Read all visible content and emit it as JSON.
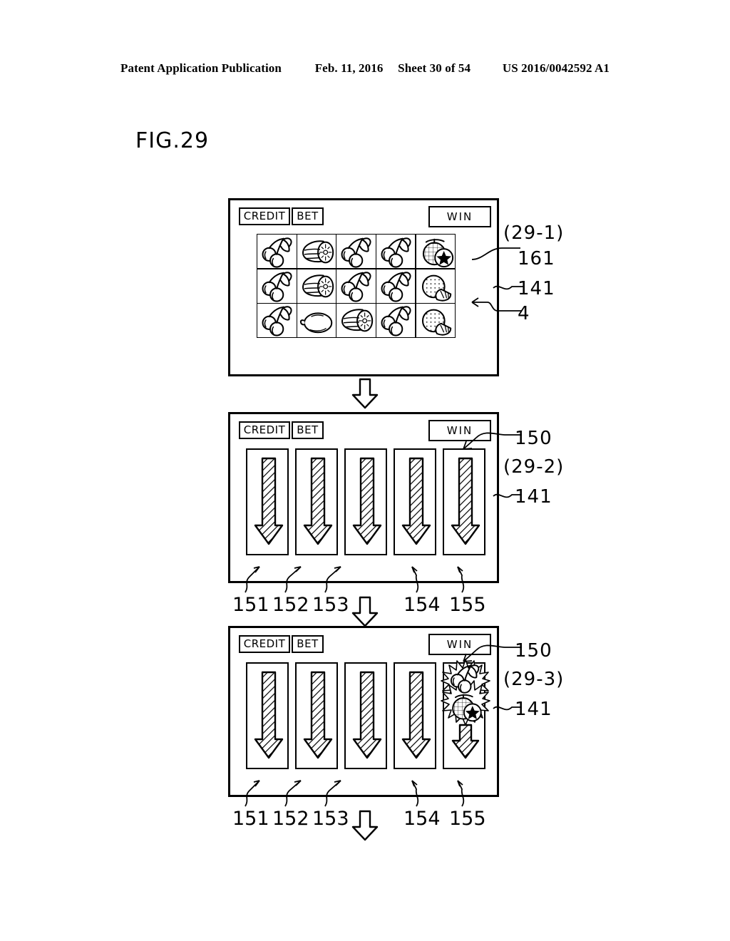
{
  "header": {
    "publication": "Patent Application Publication",
    "date": "Feb. 11, 2016",
    "sheet": "Sheet 30 of 54",
    "patent_number": "US 2016/0042592 A1"
  },
  "figure": {
    "label": "FIG.29"
  },
  "meters": {
    "credit_label": "CREDIT",
    "bet_label": "BET",
    "win_label": "WIN"
  },
  "panels": [
    {
      "id": "29-1",
      "step_label": "(29-1)",
      "callouts": [
        "161",
        "141",
        "4"
      ],
      "grid": {
        "columns": 5,
        "rows": 3,
        "symbols": [
          [
            "cherry",
            "melon-slice",
            "cherry",
            "cherry",
            "melon-star"
          ],
          [
            "cherry",
            "melon-slice",
            "cherry",
            "cherry",
            "orange-slice"
          ],
          [
            "cherry",
            "plum",
            "melon-slice",
            "cherry",
            "orange-slice"
          ]
        ]
      }
    },
    {
      "id": "29-2",
      "step_label": "(29-2)",
      "callouts": [
        "150",
        "141"
      ],
      "reels": [
        {
          "ref": "151",
          "content": "down-arrow"
        },
        {
          "ref": "152",
          "content": "down-arrow"
        },
        {
          "ref": "153",
          "content": "down-arrow"
        },
        {
          "ref": "154",
          "content": "down-arrow"
        },
        {
          "ref": "155",
          "content": "down-arrow"
        }
      ]
    },
    {
      "id": "29-3",
      "step_label": "(29-3)",
      "callouts": [
        "150",
        "141"
      ],
      "reels": [
        {
          "ref": "151",
          "content": "down-arrow"
        },
        {
          "ref": "152",
          "content": "down-arrow"
        },
        {
          "ref": "153",
          "content": "down-arrow"
        },
        {
          "ref": "154",
          "content": "down-arrow"
        },
        {
          "ref": "155",
          "content": "burst-symbols-arrow"
        }
      ]
    }
  ],
  "reel_refs": {
    "r1": "151",
    "r2": "152",
    "r3": "153",
    "r4": "154",
    "r5": "155"
  },
  "colors": {
    "line": "#000000",
    "background": "#ffffff",
    "hatch": "#000000"
  }
}
